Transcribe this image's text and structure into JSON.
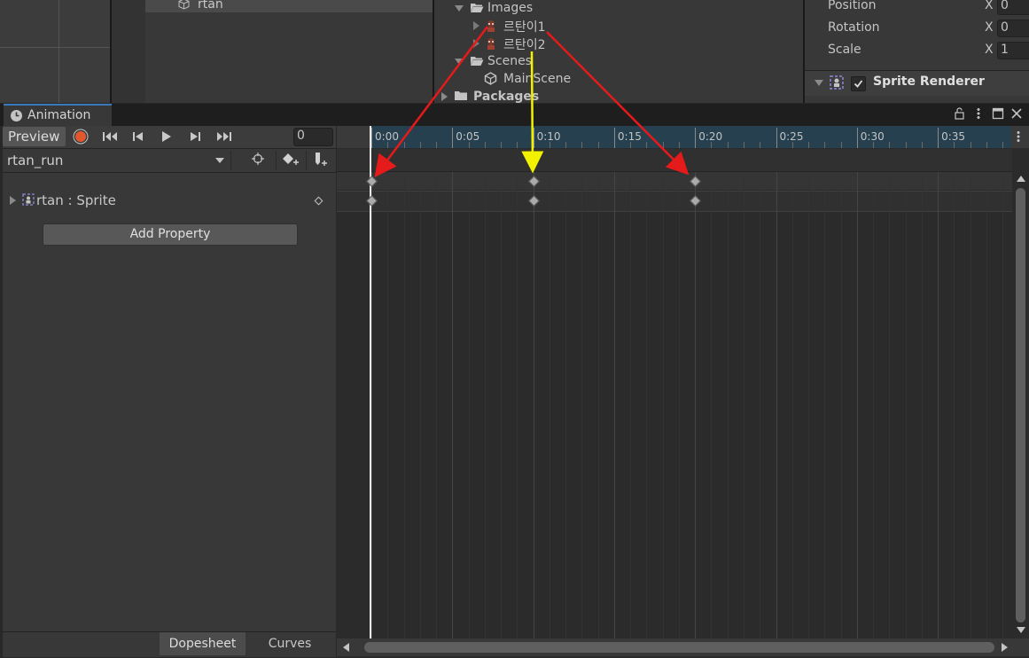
{
  "hierarchy": {
    "item": "rtan"
  },
  "project": {
    "images_folder": "Images",
    "sprite1": "르탄이1",
    "sprite2": "르탄이2",
    "scenes_folder": "Scenes",
    "main_scene": "MainScene",
    "packages_folder": "Packages"
  },
  "inspector": {
    "position_label": "Position",
    "rotation_label": "Rotation",
    "scale_label": "Scale",
    "axis_x": "X",
    "position_x": "0",
    "rotation_x": "0",
    "scale_x": "1",
    "component_title": "Sprite Renderer"
  },
  "animation": {
    "tab_label": "Animation",
    "preview_label": "Preview",
    "frame_value": "0",
    "clip_name": "rtan_run",
    "property_label": "rtan : Sprite",
    "add_property_label": "Add Property",
    "dopesheet_label": "Dopesheet",
    "curves_label": "Curves",
    "ticks": [
      "0:00",
      "0:05",
      "0:10",
      "0:15",
      "0:20",
      "0:25",
      "0:30",
      "0:35"
    ]
  },
  "colors": {
    "accent_red": "#e51a1a",
    "accent_yellow": "#f2f200",
    "record_red": "#e4572e",
    "ruler_blue": "#26404f"
  }
}
